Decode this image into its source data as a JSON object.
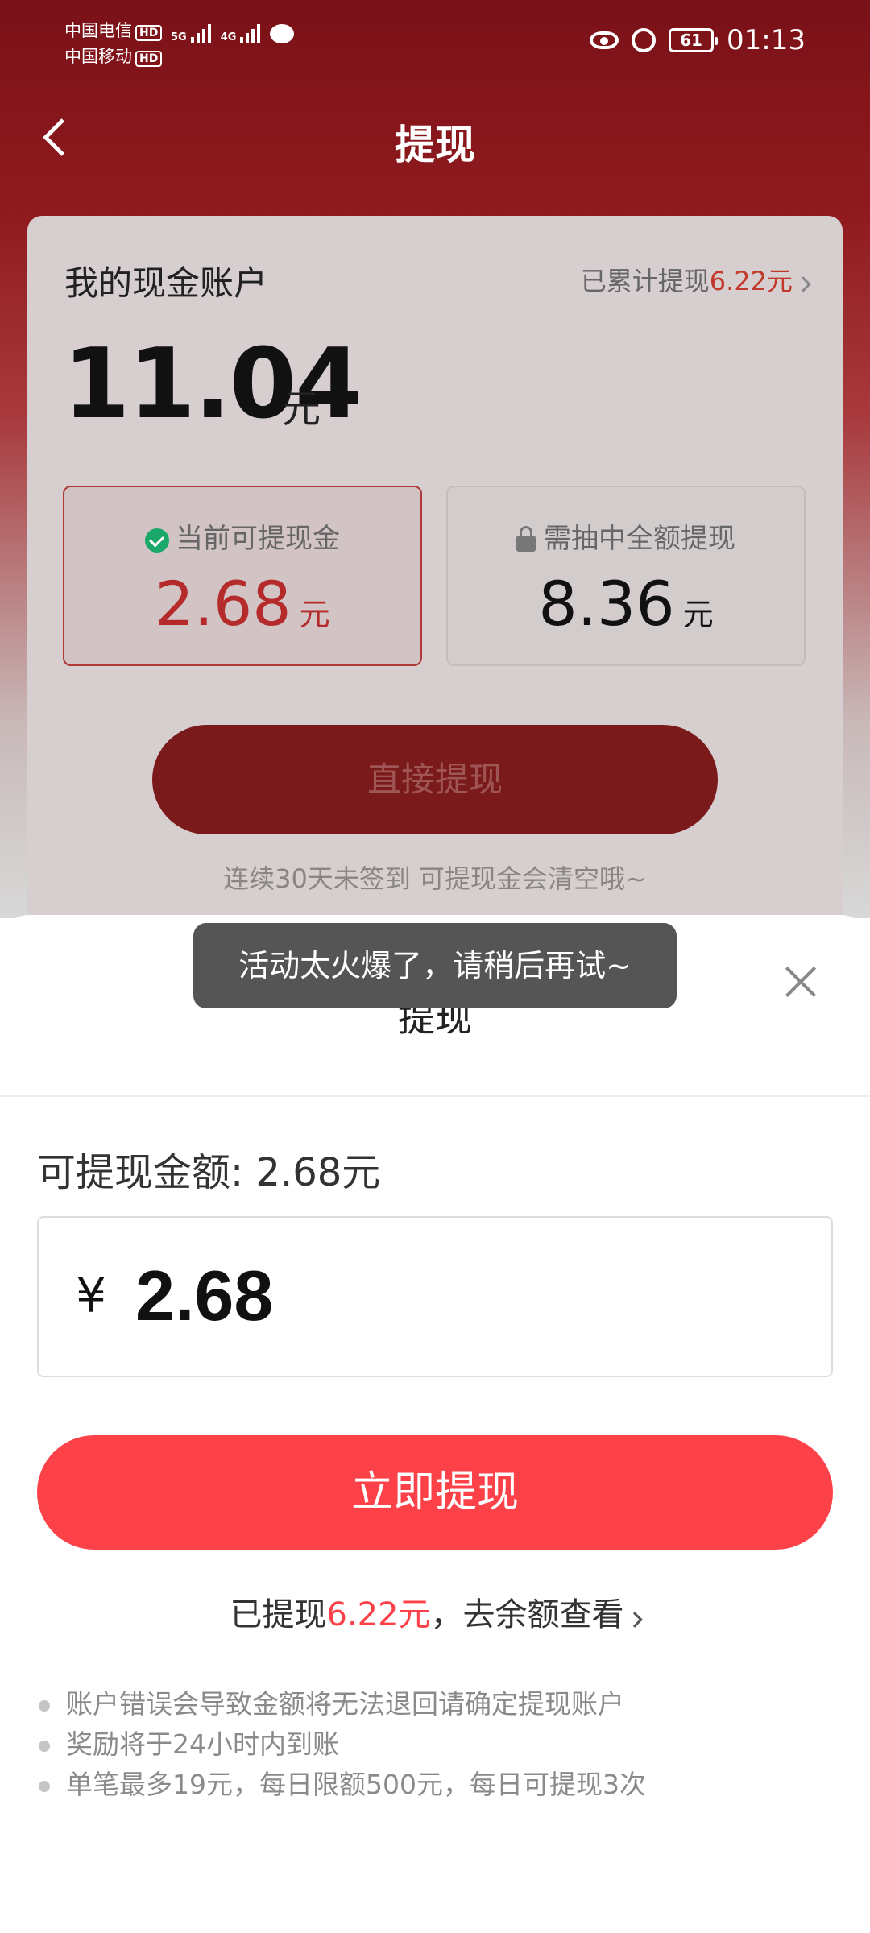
{
  "status_bar": {
    "carrier_1": "中国电信",
    "carrier_2": "中国移动",
    "hd_label": "HD",
    "net_1": "5G",
    "net_2": "4G",
    "battery": "61",
    "time": "01:13"
  },
  "nav": {
    "title": "提现"
  },
  "account": {
    "title": "我的现金账户",
    "total_withdrawn_prefix": "已累计提现",
    "total_withdrawn_value": "6.22元",
    "balance": "11.04",
    "balance_unit": "元",
    "available_label": "当前可提现金",
    "available_value": "2.68",
    "available_unit": "元",
    "locked_label": "需抽中全额提现",
    "locked_value": "8.36",
    "locked_unit": "元",
    "direct_button": "直接提现",
    "sign_tip": "连续30天未签到 可提现金会清空哦~"
  },
  "toast": {
    "message": "活动太火爆了，请稍后再试~"
  },
  "sheet": {
    "title": "提现",
    "available_text": "可提现金额: 2.68元",
    "currency_symbol": "¥",
    "amount_value": "2.68",
    "submit_button": "立即提现",
    "withdrawn_prefix": "已提现",
    "withdrawn_value": "6.22元",
    "withdrawn_suffix": "，去余额查看",
    "rules": [
      "账户错误会导致金额将无法退回请确定提现账户",
      "奖励将于24小时内到账",
      "单笔最多19元，每日限额500元，每日可提现3次"
    ]
  },
  "colors": {
    "accent_red": "#fc4149",
    "header_dark_red": "#7a1118",
    "success_green": "#1aa86a"
  },
  "icons": [
    "back-arrow-icon",
    "eye-icon",
    "alarm-icon",
    "check-circle-icon",
    "lock-icon",
    "close-icon",
    "chevron-right-icon",
    "message-icon"
  ]
}
